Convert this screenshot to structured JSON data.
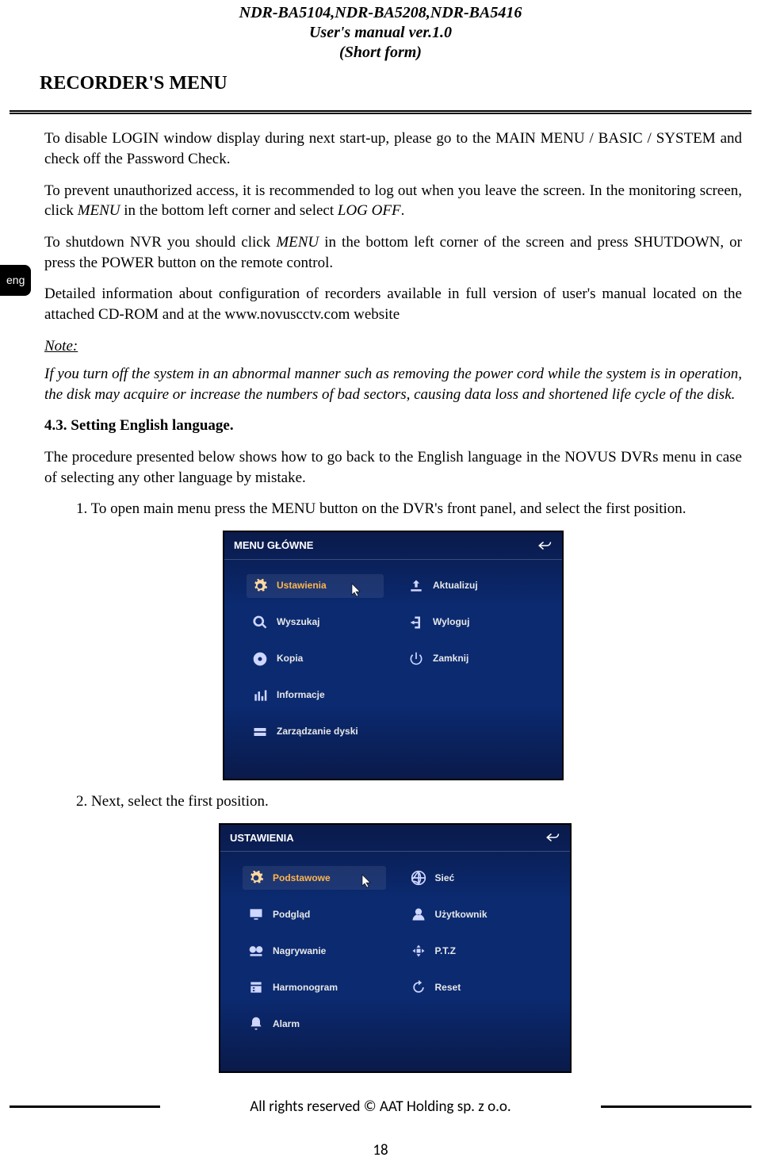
{
  "header": {
    "models": "NDR-BA5104,NDR-BA5208,NDR-BA5416",
    "manual": "User's manual ver.1.0",
    "form": "(Short form)"
  },
  "section_title": "RECORDER'S MENU",
  "lang_tab": "eng",
  "paras": {
    "p1": "To disable LOGIN window display during next start-up, please go to the MAIN MENU / BASIC / SYSTEM   and check off the Password Check.",
    "p2a": "To prevent unauthorized access, it is recommended to log out when you leave the screen. In the monitoring screen, click ",
    "p2b": "MENU",
    "p2c": " in the bottom left corner and select ",
    "p2d": "LOG OFF",
    "p2e": ".",
    "p3a": "To shutdown NVR you should click ",
    "p3b": "MENU",
    "p3c": " in the bottom left corner of the screen and press SHUTDOWN, or press the POWER button on the remote control.",
    "p4": "Detailed information about configuration of recorders available in full version of user's manual located on the attached CD-ROM and at the www.novuscctv.com website",
    "note_label": "Note:",
    "note_body": "If you turn off the system in an abnormal manner such as removing the power cord while the system is in operation, the disk may acquire or increase the numbers of bad sectors, causing data loss and shortened life cycle of the disk.",
    "subhead": "4.3. Setting English language.",
    "p5": "The procedure presented below shows how to go back to the English language in the NOVUS DVRs menu in case of selecting any other language by mistake.",
    "step1": "1. To open main menu press the MENU button on the DVR's front panel, and select the first position.",
    "step2": "2. Next, select the first position."
  },
  "menu1": {
    "title": "MENU GŁÓWNE",
    "items": {
      "ustawienia": "Ustawienia",
      "wyszukaj": "Wyszukaj",
      "kopia": "Kopia",
      "informacje": "Informacje",
      "dyski": "Zarządzanie dyski",
      "aktualizuj": "Aktualizuj",
      "wyloguj": "Wyloguj",
      "zamknij": "Zamknij"
    }
  },
  "menu2": {
    "title": "USTAWIENIA",
    "items": {
      "podstawowe": "Podstawowe",
      "podglad": "Podgląd",
      "nagrywanie": "Nagrywanie",
      "harmonogram": "Harmonogram",
      "alarm": "Alarm",
      "siec": "Sieć",
      "uzytkownik": "Użytkownik",
      "ptz": "P.T.Z",
      "reset": "Reset"
    }
  },
  "footer": "All rights reserved © AAT Holding sp. z o.o.",
  "pagenum": "18"
}
